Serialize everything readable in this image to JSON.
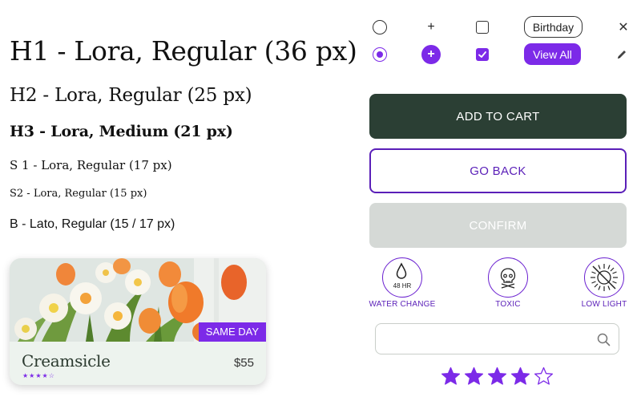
{
  "typography": {
    "h1": "H1 - Lora, Regular (36 px)",
    "h2": "H2 - Lora, Regular (25 px)",
    "h3": "H3 - Lora, Medium (21 px)",
    "s1": "S 1 - Lora, Regular (17 px)",
    "s2": "S2 - Lora, Regular (15 px)",
    "b": "B - Lato, Regular (15 / 17 px)"
  },
  "product_card": {
    "badge": "SAME DAY",
    "title": "Creamsicle",
    "price": "$55",
    "rating_stars": "★★★★☆",
    "rating_value": 4,
    "rating_max": 5
  },
  "controls": {
    "plus_symbol": "+",
    "chip_outline_label": "Birthday",
    "chip_filled_label": "View All",
    "close_symbol": "✕"
  },
  "buttons": {
    "primary_label": "ADD TO CART",
    "outline_label": "GO BACK",
    "disabled_label": "CONFIRM"
  },
  "care": {
    "water_label": "WATER CHANGE",
    "water_value": "48 HR",
    "toxic_label": "TOXIC",
    "light_label": "LOW LIGHT"
  },
  "search": {
    "value": "",
    "placeholder": ""
  },
  "rating": {
    "value": 4,
    "max": 5
  },
  "colors": {
    "accent_purple": "#7c2ae8",
    "dark_green": "#2b3f34",
    "disabled_gray": "#d5d9d6",
    "card_bg": "#edf3ee"
  },
  "icons": [
    "radio-empty",
    "radio-checked",
    "plus-icon",
    "plus-circle-icon",
    "checkbox-empty",
    "checkbox-checked",
    "close-icon",
    "pencil-icon",
    "water-drop-icon",
    "skull-icon",
    "low-light-icon",
    "search-icon",
    "star-icon"
  ]
}
